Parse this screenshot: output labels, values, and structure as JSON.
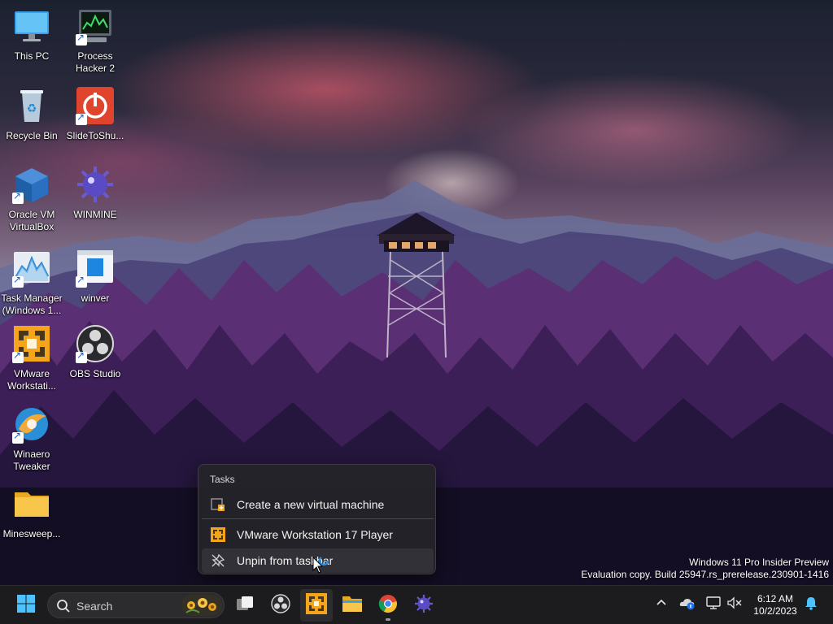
{
  "desktop": {
    "icons": [
      {
        "id": "this-pc",
        "label": "This PC"
      },
      {
        "id": "recycle-bin",
        "label": "Recycle Bin"
      },
      {
        "id": "virtualbox",
        "label": "Oracle VM VirtualBox"
      },
      {
        "id": "task-manager",
        "label": "Task Manager (Windows 1..."
      },
      {
        "id": "vmware",
        "label": "VMware Workstati..."
      },
      {
        "id": "winaero",
        "label": "Winaero Tweaker"
      },
      {
        "id": "minesweeper",
        "label": "Minesweep..."
      },
      {
        "id": "process-hacker",
        "label": "Process Hacker 2"
      },
      {
        "id": "slidetoshutdown",
        "label": "SlideToShu..."
      },
      {
        "id": "winmine",
        "label": "WINMINE"
      },
      {
        "id": "winver",
        "label": "winver"
      },
      {
        "id": "obs",
        "label": "OBS Studio"
      }
    ]
  },
  "jumplist": {
    "header": "Tasks",
    "items": [
      {
        "label": "Create a new virtual machine",
        "icon": "new-vm-icon"
      },
      {
        "label": "VMware Workstation 17 Player",
        "icon": "vmware-icon"
      },
      {
        "label": "Unpin from taskbar",
        "icon": "unpin-icon"
      }
    ]
  },
  "watermark": {
    "line1": "Windows 11 Pro Insider Preview",
    "line2": "Evaluation copy. Build 25947.rs_prerelease.230901-1416"
  },
  "taskbar": {
    "search_placeholder": "Search",
    "apps": [
      "start-icon",
      "task-view-icon",
      "obs-icon",
      "vmware-icon",
      "file-explorer-icon",
      "chrome-icon",
      "winmine-icon"
    ],
    "tray": [
      "chevron-up-icon",
      "onedrive-icon",
      "network-icon",
      "volume-muted-icon",
      "notification-bell-icon"
    ],
    "clock_time": "6:12 AM",
    "clock_date": "10/2/2023"
  },
  "colors": {
    "taskbar_bg": "#1c1c1e",
    "jumplist_bg": "#242428",
    "accent": "#0078d4",
    "vmware_orange": "#f4a51c"
  }
}
